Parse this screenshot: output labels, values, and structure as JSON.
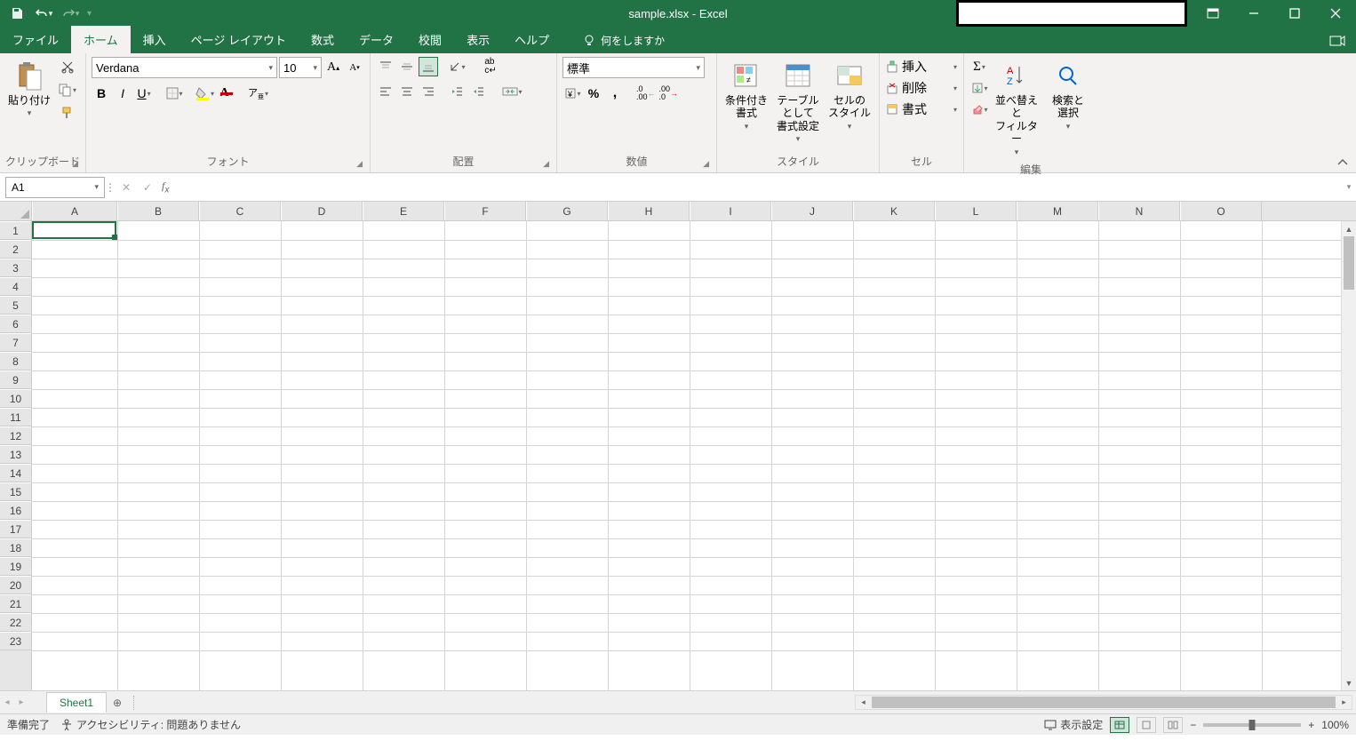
{
  "title": "sample.xlsx  -  Excel",
  "tabs": [
    "ファイル",
    "ホーム",
    "挿入",
    "ページ レイアウト",
    "数式",
    "データ",
    "校閲",
    "表示",
    "ヘルプ"
  ],
  "active_tab": 1,
  "tell_me": "何をしますか",
  "ribbon": {
    "clipboard": {
      "paste": "貼り付け",
      "label": "クリップボード"
    },
    "font": {
      "name": "Verdana",
      "size": "10",
      "label": "フォント"
    },
    "alignment": {
      "wrap": "ab",
      "label": "配置"
    },
    "number": {
      "format": "標準",
      "label": "数値"
    },
    "styles": {
      "cond": "条件付き\n書式",
      "table": "テーブルとして\n書式設定",
      "cell": "セルの\nスタイル",
      "label": "スタイル"
    },
    "cells": {
      "insert": "挿入",
      "delete": "削除",
      "format": "書式",
      "label": "セル"
    },
    "editing": {
      "sort": "並べ替えと\nフィルター",
      "find": "検索と\n選択",
      "label": "編集"
    }
  },
  "namebox": "A1",
  "columns": [
    "A",
    "B",
    "C",
    "D",
    "E",
    "F",
    "G",
    "H",
    "I",
    "J",
    "K",
    "L",
    "M",
    "N",
    "O"
  ],
  "rows": 23,
  "sheet_tab": "Sheet1",
  "status": {
    "ready": "準備完了",
    "a11y": "アクセシビリティ: 問題ありません",
    "display": "表示設定",
    "zoom": "100%"
  }
}
